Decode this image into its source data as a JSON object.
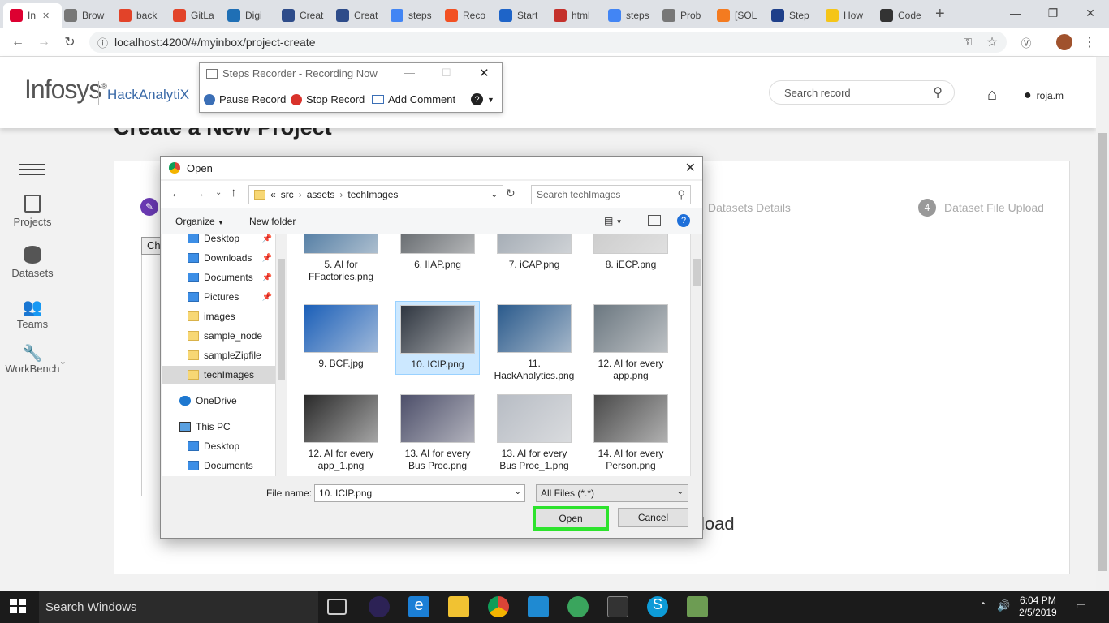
{
  "browser": {
    "tabs": [
      {
        "label": "In",
        "color": "#dd0031",
        "icon": "angular-icon"
      },
      {
        "label": "Brow",
        "color": "#777777",
        "icon": "page-icon"
      },
      {
        "label": "back",
        "color": "#e24329",
        "icon": "gitlab-icon"
      },
      {
        "label": "GitLa",
        "color": "#e24329",
        "icon": "gitlab-icon"
      },
      {
        "label": "Digi",
        "color": "#1f6fb5",
        "icon": "k-icon"
      },
      {
        "label": "Creat",
        "color": "#2e4c8a",
        "icon": "app-icon"
      },
      {
        "label": "Creat",
        "color": "#2e4c8a",
        "icon": "app-icon"
      },
      {
        "label": "steps",
        "color": "#4285f4",
        "icon": "google-icon"
      },
      {
        "label": "Reco",
        "color": "#f25022",
        "icon": "microsoft-icon"
      },
      {
        "label": "Start",
        "color": "#1e64c8",
        "icon": "flag-icon"
      },
      {
        "label": "html",
        "color": "#c4302b",
        "icon": "h-icon"
      },
      {
        "label": "steps",
        "color": "#4285f4",
        "icon": "google-icon"
      },
      {
        "label": "Prob",
        "color": "#777777",
        "icon": "page-icon"
      },
      {
        "label": "[SOL",
        "color": "#f47b20",
        "icon": "stackoverflow-icon"
      },
      {
        "label": "Step",
        "color": "#1e3f8a",
        "icon": "app-icon"
      },
      {
        "label": "How",
        "color": "#f5c518",
        "icon": "l-icon"
      },
      {
        "label": "Code",
        "color": "#333333",
        "icon": "codepen-icon"
      }
    ],
    "url": "localhost:4200/#/myinbox/project-create"
  },
  "app": {
    "logo": "Infosys",
    "logo_mark": "®",
    "product": "HackAnalytiX",
    "search_placeholder": "Search record",
    "user": "roja.m",
    "sidebar": [
      {
        "label": "Projects",
        "icon": "projects-icon"
      },
      {
        "label": "Datasets",
        "icon": "datasets-icon"
      },
      {
        "label": "Teams",
        "icon": "teams-icon"
      },
      {
        "label": "WorkBench",
        "icon": "wrench-icon"
      }
    ],
    "page_title": "Create a New Project",
    "steps": [
      {
        "label": "Datasets Details"
      },
      {
        "number": "4",
        "label": "Dataset File Upload"
      }
    ],
    "choose_btn": "Ch",
    "upload_partial": "load"
  },
  "recorder": {
    "title": "Steps Recorder - Recording Now",
    "pause": "Pause Record",
    "stop": "Stop Record",
    "comment": "Add Comment"
  },
  "dialog": {
    "title": "Open",
    "breadcrumb": [
      "«",
      "src",
      "assets",
      "techImages"
    ],
    "search_placeholder": "Search techImages",
    "organize": "Organize",
    "new_folder": "New folder",
    "nav": [
      {
        "label": "Desktop",
        "pinned": true
      },
      {
        "label": "Downloads",
        "pinned": true
      },
      {
        "label": "Documents",
        "pinned": true
      },
      {
        "label": "Pictures",
        "pinned": true
      },
      {
        "label": "images",
        "pinned": false
      },
      {
        "label": "sample_node",
        "pinned": false
      },
      {
        "label": "sampleZipfile",
        "pinned": false
      },
      {
        "label": "techImages",
        "pinned": false
      },
      {
        "label": "OneDrive",
        "pinned": false
      },
      {
        "label": "This PC",
        "pinned": false
      },
      {
        "label": "Desktop",
        "pinned": false
      },
      {
        "label": "Documents",
        "pinned": false
      }
    ],
    "files": [
      {
        "name": "5. AI for FFactories.png",
        "color": "#3e6e9a"
      },
      {
        "name": "6. IIAP.png",
        "color": "#54595e"
      },
      {
        "name": "7. iCAP.png",
        "color": "#9aa3ad"
      },
      {
        "name": "8. iECP.png",
        "color": "#c8c8c8"
      },
      {
        "name": "9. BCF.jpg",
        "color": "#1b5fb8"
      },
      {
        "name": "10. ICIP.png",
        "color": "#2f3640"
      },
      {
        "name": "11. HackAnalytics.png",
        "color": "#2a5a8c"
      },
      {
        "name": "12. AI for every app.png",
        "color": "#6b7780"
      },
      {
        "name": "12. AI for every app_1.png",
        "color": "#2a2a2a"
      },
      {
        "name": "13. AI for every Bus Proc.png",
        "color": "#4d4f6a"
      },
      {
        "name": "13. AI for every Bus Proc_1.png",
        "color": "#b7bcc4"
      },
      {
        "name": "14. AI for every Person.png",
        "color": "#4a4a4a"
      }
    ],
    "selected_file": "10. ICIP.png",
    "filename_label": "File name:",
    "filename_value": "10. ICIP.png",
    "filter": "All Files (*.*)",
    "open": "Open",
    "cancel": "Cancel"
  },
  "taskbar": {
    "search": "Search Windows",
    "time": "6:04 PM",
    "date": "2/5/2019"
  }
}
